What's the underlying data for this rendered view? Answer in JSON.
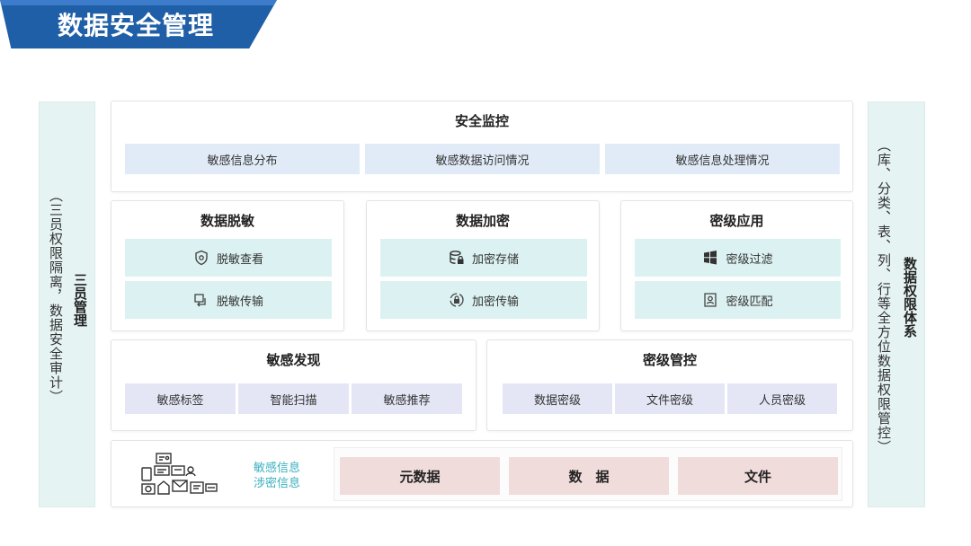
{
  "title": "数据安全管理",
  "left_side": {
    "title": "三员管理",
    "text": "（三员权限隔离，数据安全审计）"
  },
  "right_side": {
    "title": "数据权限体系",
    "text": "（库、分类、表、列、行等全方位数据权限管控）"
  },
  "monitor": {
    "title": "安全监控",
    "items": [
      "敏感信息分布",
      "敏感数据访问情况",
      "敏感信息处理情况"
    ]
  },
  "desensitize": {
    "title": "数据脱敏",
    "items": [
      {
        "label": "脱敏查看",
        "icon": "shield-eye-icon"
      },
      {
        "label": "脱敏传输",
        "icon": "transfer-icon"
      }
    ]
  },
  "encrypt": {
    "title": "数据加密",
    "items": [
      {
        "label": "加密存储",
        "icon": "database-lock-icon"
      },
      {
        "label": "加密传输",
        "icon": "lock-transfer-icon"
      }
    ]
  },
  "classification": {
    "title": "密级应用",
    "items": [
      {
        "label": "密级过滤",
        "icon": "windows-filter-icon"
      },
      {
        "label": "密级匹配",
        "icon": "person-badge-icon"
      }
    ]
  },
  "discovery": {
    "title": "敏感发现",
    "items": [
      "敏感标签",
      "智能扫描",
      "敏感推荐"
    ]
  },
  "level_control": {
    "title": "密级管控",
    "items": [
      "数据密级",
      "文件密级",
      "人员密级"
    ]
  },
  "bottom": {
    "label_line1": "敏感信息",
    "label_line2": "涉密信息",
    "items": [
      "元数据",
      "数　据",
      "文件"
    ]
  },
  "colors": {
    "title_bg": "#1f5fa8",
    "side_bg": "#e6f3f3",
    "chip_blue": "#e1ebf7",
    "chip_teal": "#dcf1f1",
    "chip_lavender": "#e4e6f5",
    "chip_pink": "#f1dcdc",
    "accent_teal": "#3ab0c0"
  }
}
